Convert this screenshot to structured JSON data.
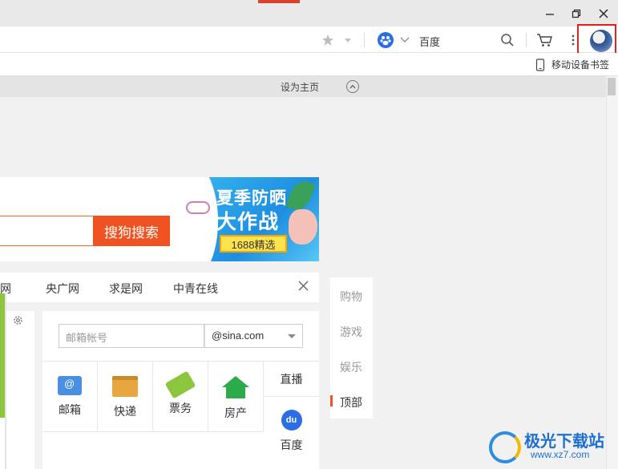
{
  "window": {
    "minimize_icon": "minimize-icon",
    "maximize_icon": "restore-icon",
    "close_icon": "close-icon",
    "accent_color": "#d9412e"
  },
  "toolbar": {
    "search_engine": "百度",
    "favorite_icon": "star-icon",
    "cart_icon": "cart-icon",
    "menu_icon": "more-vertical-icon",
    "search_icon": "search-icon"
  },
  "bookmarks": {
    "mobile_bookmarks": "移动设备书签"
  },
  "home": {
    "set_home": "设为主页"
  },
  "search": {
    "button_label": "搜狗搜索",
    "button_color": "#f05321"
  },
  "ad": {
    "line1": "夏季防晒",
    "line2": "大作战",
    "tag": "1688精选"
  },
  "links": [
    "明网",
    "央广网",
    "求是网",
    "中青在线"
  ],
  "mail": {
    "placeholder": "邮箱帐号",
    "domain": "@sina.com"
  },
  "services": [
    "邮箱",
    "快递",
    "票务",
    "房产"
  ],
  "live": "直播",
  "baidu": "百度",
  "side_nav": [
    "购物",
    "游戏",
    "娱乐",
    "顶部"
  ],
  "watermark": {
    "name": "极光下载站",
    "url": "www.xz7.com"
  }
}
